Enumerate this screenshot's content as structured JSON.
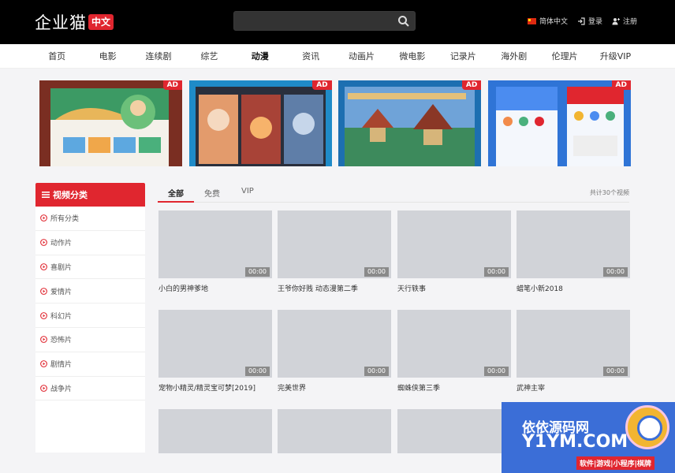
{
  "header": {
    "logo_text": "企业猫",
    "logo_badge": "中文",
    "search_placeholder": "",
    "language": "简体中文",
    "login": "登录",
    "register": "注册"
  },
  "nav": [
    {
      "label": "首页"
    },
    {
      "label": "电影"
    },
    {
      "label": "连续剧"
    },
    {
      "label": "综艺"
    },
    {
      "label": "动漫"
    },
    {
      "label": "资讯"
    },
    {
      "label": "动画片"
    },
    {
      "label": "微电影"
    },
    {
      "label": "记录片"
    },
    {
      "label": "海外剧"
    },
    {
      "label": "伦理片"
    },
    {
      "label": "升级VIP"
    }
  ],
  "ads": [
    {
      "badge": "AD"
    },
    {
      "badge": "AD"
    },
    {
      "badge": "AD"
    },
    {
      "badge": "AD"
    }
  ],
  "sidebar": {
    "title": "视频分类",
    "items": [
      {
        "label": "所有分类"
      },
      {
        "label": "动作片"
      },
      {
        "label": "喜剧片"
      },
      {
        "label": "爱情片"
      },
      {
        "label": "科幻片"
      },
      {
        "label": "恐怖片"
      },
      {
        "label": "剧情片"
      },
      {
        "label": "战争片"
      }
    ]
  },
  "tabs": [
    {
      "label": "全部"
    },
    {
      "label": "免费"
    },
    {
      "label": "VIP"
    }
  ],
  "total": "共计30个视频",
  "videos": [
    {
      "title": "小白的男神爹地",
      "duration": "00:00"
    },
    {
      "title": "王爷你好贱 动态漫第二季",
      "duration": "00:00"
    },
    {
      "title": "天行轶事",
      "duration": "00:00"
    },
    {
      "title": "蜡笔小新2018",
      "duration": "00:00"
    },
    {
      "title": "宠物小精灵/精灵宝可梦[2019]",
      "duration": "00:00"
    },
    {
      "title": "完美世界",
      "duration": "00:00"
    },
    {
      "title": "蜘蛛侠第三季",
      "duration": "00:00"
    },
    {
      "title": "武神主宰",
      "duration": "00:00"
    },
    {
      "title": "",
      "duration": ""
    },
    {
      "title": "",
      "duration": ""
    },
    {
      "title": "",
      "duration": ""
    }
  ],
  "watermark": {
    "line1": "依依源码网",
    "line2": "Y1YM.COM",
    "line3": "软件|游戏|小程序|棋牌"
  },
  "colors": {
    "accent": "#e0262f",
    "header_bg": "#000000",
    "thumb": "#d1d3d8"
  }
}
